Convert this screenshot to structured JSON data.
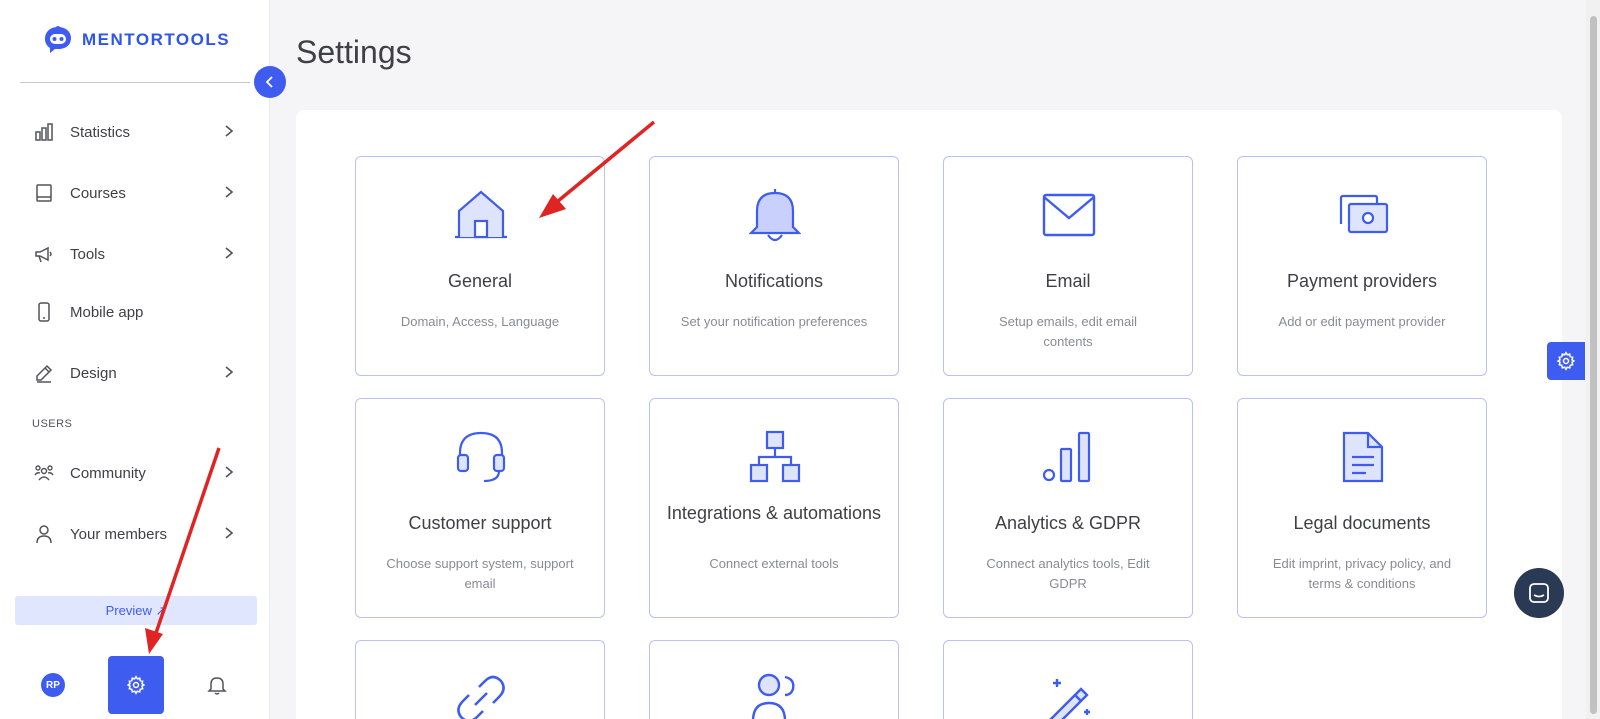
{
  "app": {
    "brand": "MENTORTOOLS"
  },
  "sidebar": {
    "items": [
      {
        "label": "Statistics",
        "icon": "bar-chart-icon"
      },
      {
        "label": "Courses",
        "icon": "book-icon"
      },
      {
        "label": "Tools",
        "icon": "megaphone-icon"
      },
      {
        "label": "Mobile app",
        "icon": "mobile-icon"
      },
      {
        "label": "Design",
        "icon": "pencil-icon"
      },
      {
        "label": "Community",
        "icon": "community-icon"
      },
      {
        "label": "Your members",
        "icon": "user-icon"
      }
    ],
    "section_users": "USERS",
    "preview_label": "Preview ↗",
    "avatar_initials": "RP"
  },
  "main": {
    "title": "Settings",
    "cards": [
      {
        "title": "General",
        "desc": "Domain, Access, Language",
        "icon": "house-icon"
      },
      {
        "title": "Notifications",
        "desc": "Set your notification preferences",
        "icon": "bell-icon"
      },
      {
        "title": "Email",
        "desc": "Setup emails, edit email contents",
        "icon": "envelope-icon"
      },
      {
        "title": "Payment providers",
        "desc": "Add or edit payment provider",
        "icon": "money-icon"
      },
      {
        "title": "Customer support",
        "desc": "Choose support system, support email",
        "icon": "headset-icon"
      },
      {
        "title": "Integrations & automations",
        "desc": "Connect external tools",
        "icon": "hierarchy-icon"
      },
      {
        "title": "Analytics & GDPR",
        "desc": "Connect analytics tools, Edit GDPR",
        "icon": "analytics-icon"
      },
      {
        "title": "Legal documents",
        "desc": "Edit imprint, privacy policy, and terms & conditions",
        "icon": "document-icon"
      }
    ]
  },
  "colors": {
    "accent": "#3f5cf0",
    "arrow": "#e02424",
    "card_border": "#b9c1f7"
  }
}
